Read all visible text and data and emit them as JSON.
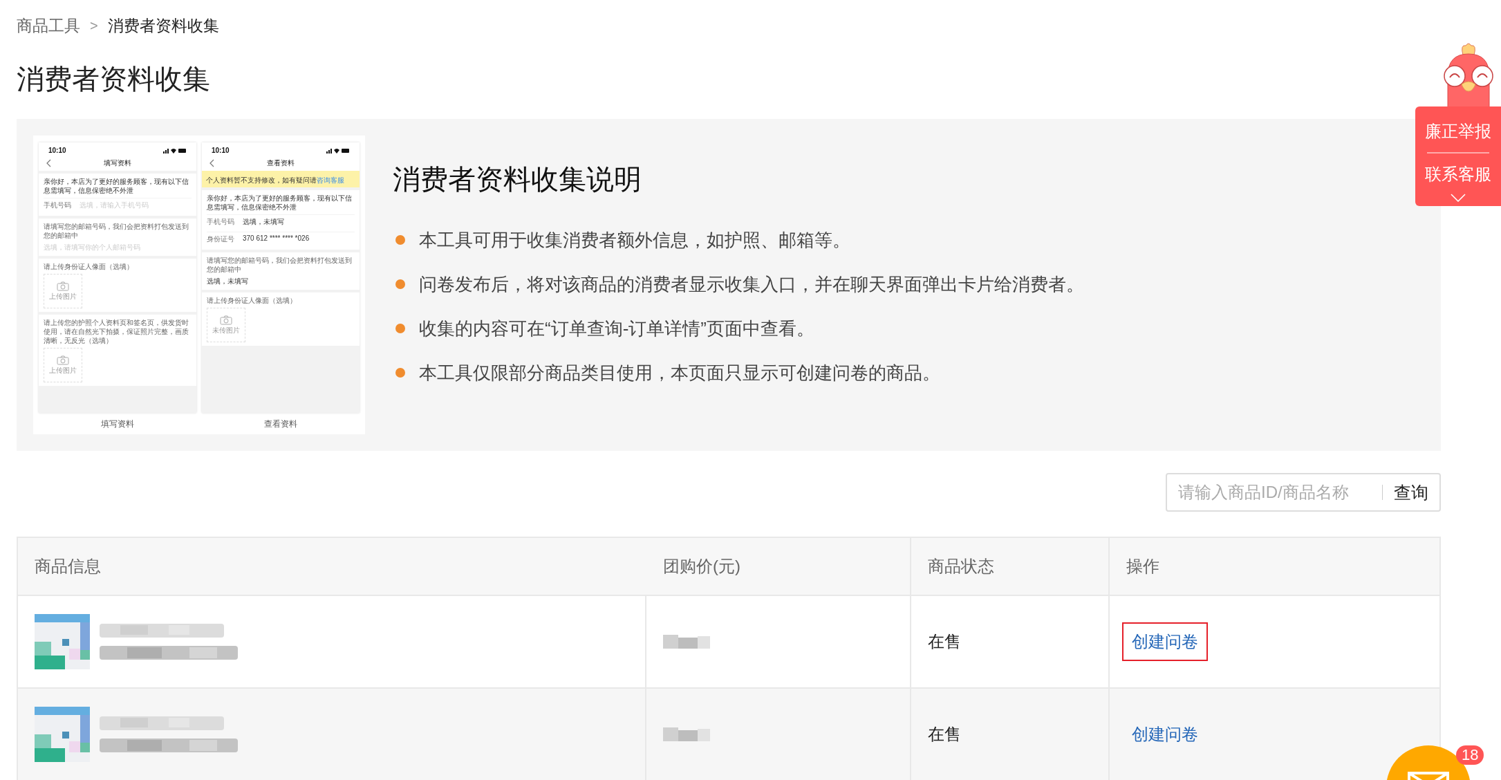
{
  "breadcrumb": {
    "separator": ">",
    "items": [
      {
        "label": "商品工具",
        "current": false
      },
      {
        "label": "消费者资料收集",
        "current": true
      }
    ]
  },
  "page_title": "消费者资料收集",
  "intro": {
    "mockups": [
      {
        "time": "10:10",
        "nav_title": "填写资料",
        "caption": "填写资料",
        "cards": [
          [
            {
              "kind": "text",
              "text": "亲你好，本店为了更好的服务顾客，现有以下信息需填写，信息保密绝不外泄"
            },
            {
              "kind": "field",
              "label": "手机号码",
              "placeholder": "选填，请输入手机号码"
            }
          ],
          [
            {
              "kind": "prompt",
              "text": "请填写您的邮箱号码，我们会把资料打包发送到您的邮箱中"
            },
            {
              "kind": "hint",
              "text": "选填，请填写你的个人邮箱号码"
            }
          ],
          [
            {
              "kind": "prompt",
              "text": "请上传身份证人像面（选填）"
            },
            {
              "kind": "upload",
              "text": "上传图片"
            }
          ],
          [
            {
              "kind": "prompt",
              "text": "请上传您的护照个人资料页和签名页，供发货时使用，请在自然光下拍摄，保证照片完整，画质清晰，无反光（选填）"
            },
            {
              "kind": "upload",
              "text": "上传图片"
            }
          ]
        ]
      },
      {
        "time": "10:10",
        "nav_title": "查看资料",
        "caption": "查看资料",
        "notice": {
          "text": "个人资料暂不支持修改，如有疑问请",
          "link": "咨询客服"
        },
        "cards": [
          [
            {
              "kind": "text",
              "text": "亲你好，本店为了更好的服务顾客，现有以下信息需填写，信息保密绝不外泄"
            },
            {
              "kind": "field",
              "label": "手机号码",
              "value": "选填，未填写"
            },
            {
              "kind": "field",
              "label": "身份证号",
              "value": "370 612 **** **** *026"
            }
          ],
          [
            {
              "kind": "prompt",
              "text": "请填写您的邮箱号码，我们会把资料打包发送到您的邮箱中"
            },
            {
              "kind": "value",
              "text": "选填，未填写"
            }
          ],
          [
            {
              "kind": "prompt",
              "text": "请上传身份证人像面（选填）"
            },
            {
              "kind": "upload",
              "text": "未传图片"
            }
          ]
        ]
      }
    ],
    "heading": "消费者资料收集说明",
    "bullets": [
      "本工具可用于收集消费者额外信息，如护照、邮箱等。",
      "问卷发布后，将对该商品的消费者显示收集入口，并在聊天界面弹出卡片给消费者。",
      "收集的内容可在“订单查询-订单详情”页面中查看。",
      "本工具仅限部分商品类目使用，本页面只显示可创建问卷的商品。"
    ]
  },
  "search": {
    "placeholder": "请输入商品ID/商品名称",
    "button": "查询"
  },
  "table": {
    "columns": [
      "商品信息",
      "团购价(元)",
      "商品状态",
      "操作"
    ],
    "rows": [
      {
        "status": "在售",
        "action": "创建问卷",
        "highlighted": true
      },
      {
        "status": "在售",
        "action": "创建问卷",
        "highlighted": false
      }
    ]
  },
  "side_widget": {
    "items": [
      "廉正举报",
      "联系客服"
    ]
  },
  "messages": {
    "badge": "18"
  }
}
